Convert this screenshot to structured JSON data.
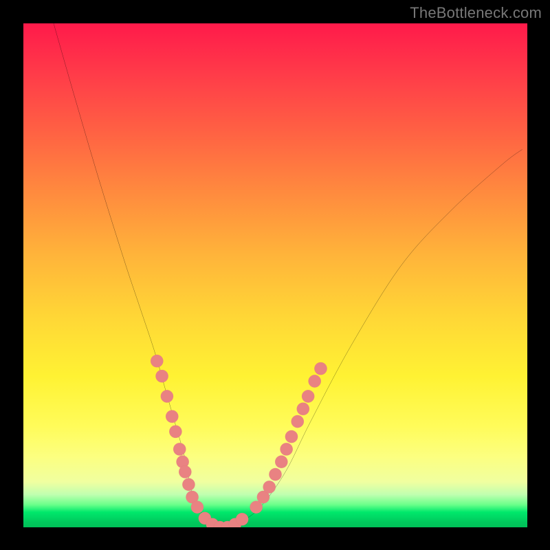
{
  "watermark": "TheBottleneck.com",
  "colors": {
    "background": "#000000",
    "gradient_top": "#ff1a4a",
    "gradient_mid": "#ffd636",
    "gradient_bottom": "#00c058",
    "curve": "#000000",
    "marker_fill": "#e98282",
    "marker_stroke": "#d46a6a"
  },
  "chart_data": {
    "type": "line",
    "title": "",
    "xlabel": "",
    "ylabel": "",
    "xlim": [
      0,
      100
    ],
    "ylim": [
      0,
      100
    ],
    "grid": false,
    "legend": false,
    "series": [
      {
        "name": "bottleneck-curve",
        "x": [
          6,
          10,
          15,
          20,
          23,
          26,
          28,
          30,
          32,
          33,
          34,
          36,
          38,
          40,
          43,
          47,
          52,
          57,
          65,
          75,
          85,
          95,
          99
        ],
        "y": [
          100,
          86,
          69,
          53,
          44,
          35,
          28,
          21,
          14,
          9,
          5,
          2,
          0.5,
          0,
          1,
          4,
          11,
          21,
          36,
          52,
          63,
          72,
          75
        ]
      }
    ],
    "markers": [
      {
        "name": "left-cluster",
        "points": [
          {
            "x": 26.5,
            "y": 33
          },
          {
            "x": 27.5,
            "y": 30
          },
          {
            "x": 28.5,
            "y": 26
          },
          {
            "x": 29.5,
            "y": 22
          },
          {
            "x": 30.2,
            "y": 19
          },
          {
            "x": 31.0,
            "y": 15.5
          },
          {
            "x": 31.6,
            "y": 13
          },
          {
            "x": 32.1,
            "y": 11
          },
          {
            "x": 32.8,
            "y": 8.5
          },
          {
            "x": 33.5,
            "y": 6
          },
          {
            "x": 34.5,
            "y": 4
          }
        ]
      },
      {
        "name": "bottom-cluster",
        "points": [
          {
            "x": 36.0,
            "y": 1.8
          },
          {
            "x": 37.5,
            "y": 0.6
          },
          {
            "x": 39.0,
            "y": 0
          },
          {
            "x": 40.5,
            "y": 0
          },
          {
            "x": 42.0,
            "y": 0.6
          },
          {
            "x": 43.4,
            "y": 1.6
          }
        ]
      },
      {
        "name": "right-cluster",
        "points": [
          {
            "x": 46.2,
            "y": 4
          },
          {
            "x": 47.6,
            "y": 6
          },
          {
            "x": 48.8,
            "y": 8
          },
          {
            "x": 50.0,
            "y": 10.5
          },
          {
            "x": 51.2,
            "y": 13
          },
          {
            "x": 52.2,
            "y": 15.5
          },
          {
            "x": 53.2,
            "y": 18
          },
          {
            "x": 54.4,
            "y": 21
          },
          {
            "x": 55.5,
            "y": 23.5
          },
          {
            "x": 56.5,
            "y": 26
          },
          {
            "x": 57.8,
            "y": 29
          },
          {
            "x": 59.0,
            "y": 31.5
          }
        ]
      }
    ]
  }
}
